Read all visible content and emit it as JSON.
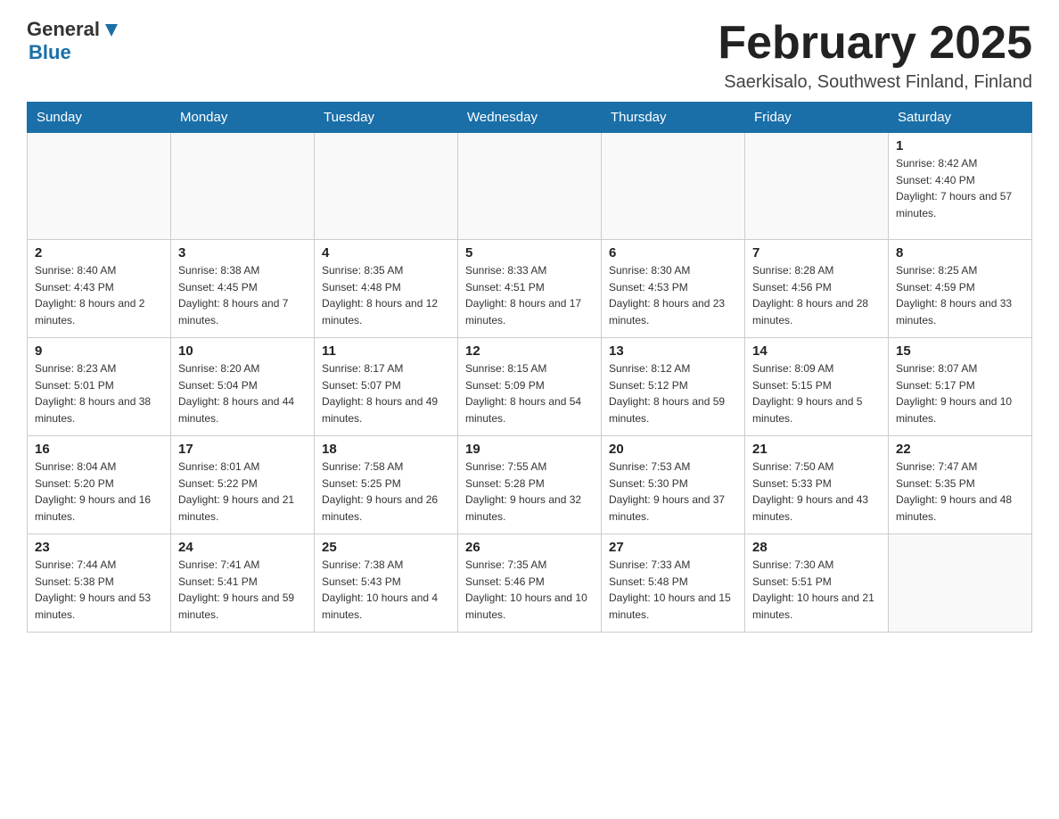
{
  "header": {
    "logo": {
      "general": "General",
      "blue": "Blue"
    },
    "title": "February 2025",
    "location": "Saerkisalo, Southwest Finland, Finland"
  },
  "weekdays": [
    "Sunday",
    "Monday",
    "Tuesday",
    "Wednesday",
    "Thursday",
    "Friday",
    "Saturday"
  ],
  "weeks": [
    [
      {
        "day": "",
        "info": ""
      },
      {
        "day": "",
        "info": ""
      },
      {
        "day": "",
        "info": ""
      },
      {
        "day": "",
        "info": ""
      },
      {
        "day": "",
        "info": ""
      },
      {
        "day": "",
        "info": ""
      },
      {
        "day": "1",
        "info": "Sunrise: 8:42 AM\nSunset: 4:40 PM\nDaylight: 7 hours and 57 minutes."
      }
    ],
    [
      {
        "day": "2",
        "info": "Sunrise: 8:40 AM\nSunset: 4:43 PM\nDaylight: 8 hours and 2 minutes."
      },
      {
        "day": "3",
        "info": "Sunrise: 8:38 AM\nSunset: 4:45 PM\nDaylight: 8 hours and 7 minutes."
      },
      {
        "day": "4",
        "info": "Sunrise: 8:35 AM\nSunset: 4:48 PM\nDaylight: 8 hours and 12 minutes."
      },
      {
        "day": "5",
        "info": "Sunrise: 8:33 AM\nSunset: 4:51 PM\nDaylight: 8 hours and 17 minutes."
      },
      {
        "day": "6",
        "info": "Sunrise: 8:30 AM\nSunset: 4:53 PM\nDaylight: 8 hours and 23 minutes."
      },
      {
        "day": "7",
        "info": "Sunrise: 8:28 AM\nSunset: 4:56 PM\nDaylight: 8 hours and 28 minutes."
      },
      {
        "day": "8",
        "info": "Sunrise: 8:25 AM\nSunset: 4:59 PM\nDaylight: 8 hours and 33 minutes."
      }
    ],
    [
      {
        "day": "9",
        "info": "Sunrise: 8:23 AM\nSunset: 5:01 PM\nDaylight: 8 hours and 38 minutes."
      },
      {
        "day": "10",
        "info": "Sunrise: 8:20 AM\nSunset: 5:04 PM\nDaylight: 8 hours and 44 minutes."
      },
      {
        "day": "11",
        "info": "Sunrise: 8:17 AM\nSunset: 5:07 PM\nDaylight: 8 hours and 49 minutes."
      },
      {
        "day": "12",
        "info": "Sunrise: 8:15 AM\nSunset: 5:09 PM\nDaylight: 8 hours and 54 minutes."
      },
      {
        "day": "13",
        "info": "Sunrise: 8:12 AM\nSunset: 5:12 PM\nDaylight: 8 hours and 59 minutes."
      },
      {
        "day": "14",
        "info": "Sunrise: 8:09 AM\nSunset: 5:15 PM\nDaylight: 9 hours and 5 minutes."
      },
      {
        "day": "15",
        "info": "Sunrise: 8:07 AM\nSunset: 5:17 PM\nDaylight: 9 hours and 10 minutes."
      }
    ],
    [
      {
        "day": "16",
        "info": "Sunrise: 8:04 AM\nSunset: 5:20 PM\nDaylight: 9 hours and 16 minutes."
      },
      {
        "day": "17",
        "info": "Sunrise: 8:01 AM\nSunset: 5:22 PM\nDaylight: 9 hours and 21 minutes."
      },
      {
        "day": "18",
        "info": "Sunrise: 7:58 AM\nSunset: 5:25 PM\nDaylight: 9 hours and 26 minutes."
      },
      {
        "day": "19",
        "info": "Sunrise: 7:55 AM\nSunset: 5:28 PM\nDaylight: 9 hours and 32 minutes."
      },
      {
        "day": "20",
        "info": "Sunrise: 7:53 AM\nSunset: 5:30 PM\nDaylight: 9 hours and 37 minutes."
      },
      {
        "day": "21",
        "info": "Sunrise: 7:50 AM\nSunset: 5:33 PM\nDaylight: 9 hours and 43 minutes."
      },
      {
        "day": "22",
        "info": "Sunrise: 7:47 AM\nSunset: 5:35 PM\nDaylight: 9 hours and 48 minutes."
      }
    ],
    [
      {
        "day": "23",
        "info": "Sunrise: 7:44 AM\nSunset: 5:38 PM\nDaylight: 9 hours and 53 minutes."
      },
      {
        "day": "24",
        "info": "Sunrise: 7:41 AM\nSunset: 5:41 PM\nDaylight: 9 hours and 59 minutes."
      },
      {
        "day": "25",
        "info": "Sunrise: 7:38 AM\nSunset: 5:43 PM\nDaylight: 10 hours and 4 minutes."
      },
      {
        "day": "26",
        "info": "Sunrise: 7:35 AM\nSunset: 5:46 PM\nDaylight: 10 hours and 10 minutes."
      },
      {
        "day": "27",
        "info": "Sunrise: 7:33 AM\nSunset: 5:48 PM\nDaylight: 10 hours and 15 minutes."
      },
      {
        "day": "28",
        "info": "Sunrise: 7:30 AM\nSunset: 5:51 PM\nDaylight: 10 hours and 21 minutes."
      },
      {
        "day": "",
        "info": ""
      }
    ]
  ]
}
